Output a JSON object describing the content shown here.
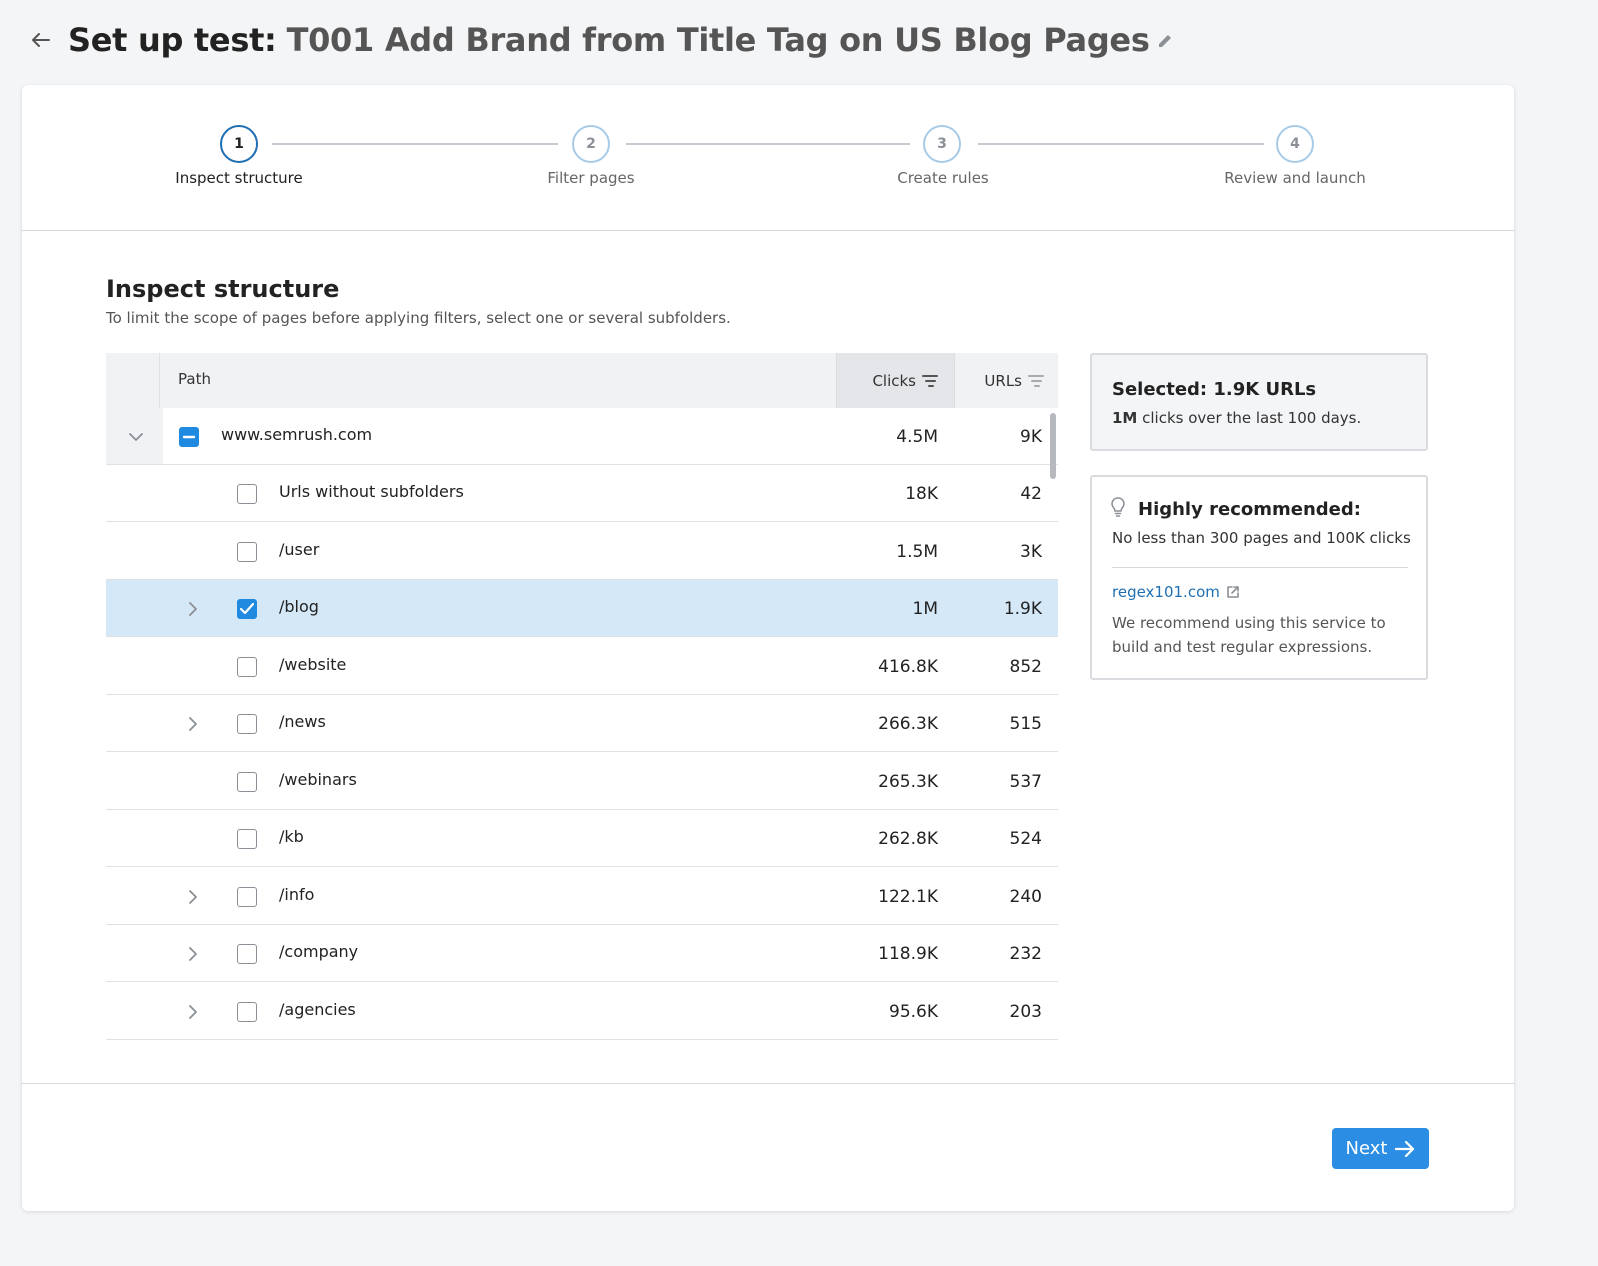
{
  "header": {
    "title_prefix": "Set up test:",
    "title_name": "T001 Add Brand from Title Tag on US Blog Pages"
  },
  "stepper": {
    "steps": [
      {
        "number": "1",
        "label": "Inspect structure",
        "active": true
      },
      {
        "number": "2",
        "label": "Filter pages",
        "active": false
      },
      {
        "number": "3",
        "label": "Create rules",
        "active": false
      },
      {
        "number": "4",
        "label": "Review and launch",
        "active": false
      }
    ]
  },
  "section": {
    "title": "Inspect structure",
    "subtitle": "To limit the scope of pages before applying filters, select one or several subfolders."
  },
  "table": {
    "columns": {
      "path": "Path",
      "clicks": "Clicks",
      "urls": "URLs"
    },
    "rows": [
      {
        "path": "www.semrush.com",
        "clicks": "4.5M",
        "urls": "9K",
        "level": 0,
        "expandable": true,
        "expanded": true,
        "state": "indeterminate"
      },
      {
        "path": "Urls without subfolders",
        "clicks": "18K",
        "urls": "42",
        "level": 1,
        "expandable": false,
        "state": "unchecked"
      },
      {
        "path": "/user",
        "clicks": "1.5M",
        "urls": "3K",
        "level": 1,
        "expandable": false,
        "state": "unchecked"
      },
      {
        "path": "/blog",
        "clicks": "1M",
        "urls": "1.9K",
        "level": 1,
        "expandable": true,
        "state": "checked"
      },
      {
        "path": "/website",
        "clicks": "416.8K",
        "urls": "852",
        "level": 1,
        "expandable": false,
        "state": "unchecked"
      },
      {
        "path": "/news",
        "clicks": "266.3K",
        "urls": "515",
        "level": 1,
        "expandable": true,
        "state": "unchecked"
      },
      {
        "path": "/webinars",
        "clicks": "265.3K",
        "urls": "537",
        "level": 1,
        "expandable": false,
        "state": "unchecked"
      },
      {
        "path": "/kb",
        "clicks": "262.8K",
        "urls": "524",
        "level": 1,
        "expandable": false,
        "state": "unchecked"
      },
      {
        "path": "/info",
        "clicks": "122.1K",
        "urls": "240",
        "level": 1,
        "expandable": true,
        "state": "unchecked"
      },
      {
        "path": "/company",
        "clicks": "118.9K",
        "urls": "232",
        "level": 1,
        "expandable": true,
        "state": "unchecked"
      },
      {
        "path": "/agencies",
        "clicks": "95.6K",
        "urls": "203",
        "level": 1,
        "expandable": true,
        "state": "unchecked"
      }
    ]
  },
  "summary": {
    "title": "Selected: 1.9K URLs",
    "clicks_value": "1M",
    "clicks_text": " clicks over the last 100 days."
  },
  "recommendation": {
    "title": "Highly recommended:",
    "text": "No less than 300 pages and 100K clicks",
    "link_label": "regex101.com",
    "description": "We recommend using this service to build and test regular expressions."
  },
  "footer": {
    "next_label": "Next"
  },
  "colors": {
    "accent": "#2b8de3",
    "selected_row": "#d5e8f7",
    "active_step": "#1f6fb2",
    "link": "#1f6fb2"
  }
}
